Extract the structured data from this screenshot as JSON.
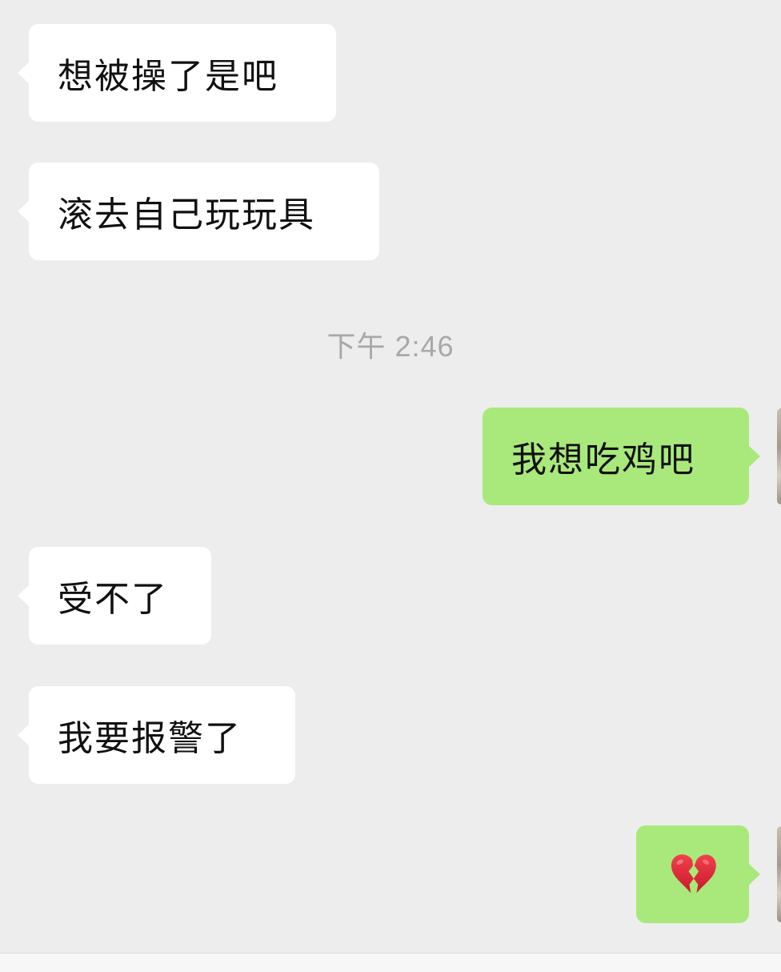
{
  "messages": [
    {
      "side": "in",
      "text": "想被操了是吧"
    },
    {
      "side": "in",
      "text": "滚去自己玩玩具"
    },
    {
      "side": "out",
      "text": "我想吃鸡吧"
    },
    {
      "side": "in",
      "text": "受不了"
    },
    {
      "side": "in",
      "text": "我要报警了"
    },
    {
      "side": "out",
      "emoji": "broken-heart"
    }
  ],
  "timestamp": "下午 2:46",
  "colors": {
    "background": "#ededed",
    "incoming_bubble": "#ffffff",
    "outgoing_bubble": "#a9e97b",
    "timestamp_text": "#a8a8a8"
  },
  "icons": {
    "broken_heart": "broken-heart-icon"
  }
}
